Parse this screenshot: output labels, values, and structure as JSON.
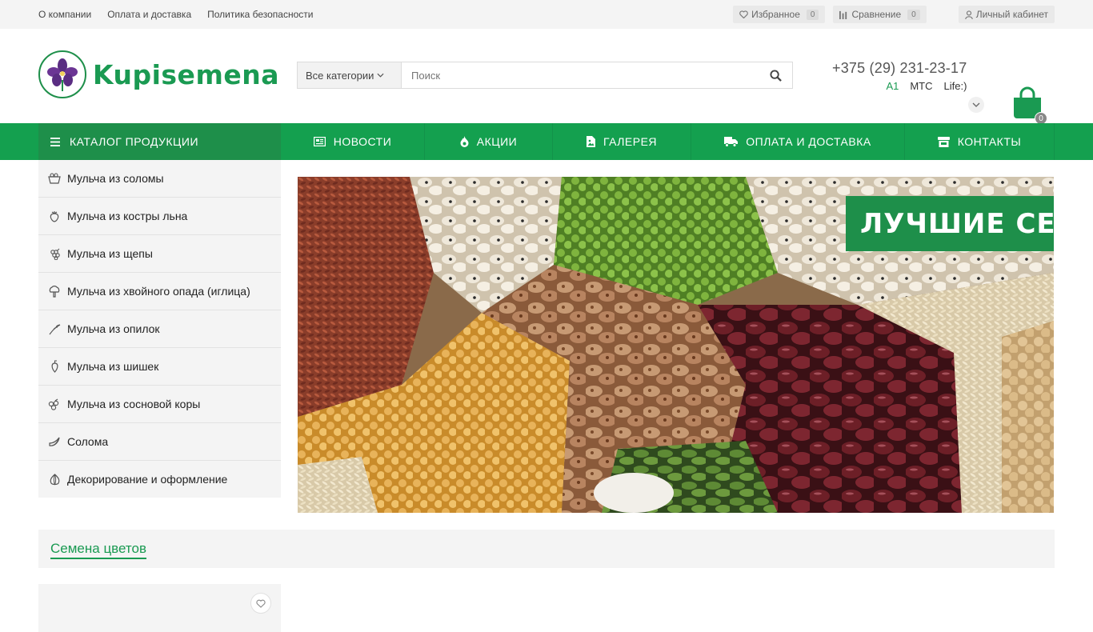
{
  "topbar": {
    "links": [
      "О компании",
      "Оплата и доставка",
      "Политика безопасности"
    ],
    "favorites": {
      "label": "Избранное",
      "count": "0"
    },
    "compare": {
      "label": "Сравнение",
      "count": "0"
    },
    "cabinet": {
      "label": "Личный кабинет"
    }
  },
  "header": {
    "logo_text": "Kupisemena",
    "search": {
      "category": "Все категории",
      "placeholder": "Поиск"
    },
    "phone": {
      "number": "+375 (29) 231-23-17",
      "operators": [
        "A1",
        "МТС",
        "Life:)"
      ]
    },
    "cart_count": "0"
  },
  "nav": {
    "catalog": "КАТАЛОГ ПРОДУКЦИИ",
    "items": [
      {
        "label": "НОВОСТИ",
        "icon": "newspaper-icon"
      },
      {
        "label": "АКЦИИ",
        "icon": "fire-icon"
      },
      {
        "label": "ГАЛЕРЕЯ",
        "icon": "image-file-icon"
      },
      {
        "label": "ОПЛАТА И ДОСТАВКА",
        "icon": "truck-icon"
      },
      {
        "label": "КОНТАКТЫ",
        "icon": "store-icon"
      }
    ]
  },
  "sidebar": {
    "items": [
      {
        "label": "Мульча из соломы",
        "icon": "basket-icon"
      },
      {
        "label": "Мульча из костры льна",
        "icon": "strawberry-icon"
      },
      {
        "label": "Мульча из щепы",
        "icon": "grapes-icon"
      },
      {
        "label": "Мульча из хвойного опада (иглица)",
        "icon": "broccoli-icon"
      },
      {
        "label": "Мульча из опилок",
        "icon": "branch-icon"
      },
      {
        "label": "Мульча из шишек",
        "icon": "pepper-icon"
      },
      {
        "label": "Мульча из сосновой коры",
        "icon": "berries-icon"
      },
      {
        "label": "Солома",
        "icon": "banana-icon"
      },
      {
        "label": "Декорирование и оформление",
        "icon": "onion-icon"
      }
    ]
  },
  "banner": {
    "text": "ЛУЧШИЕ СЕМЕНА"
  },
  "section": {
    "title": "Семена цветов"
  },
  "colors": {
    "brand": "#1a9a52",
    "nav": "#14a04f",
    "nav_dark": "#1e8f4a"
  }
}
